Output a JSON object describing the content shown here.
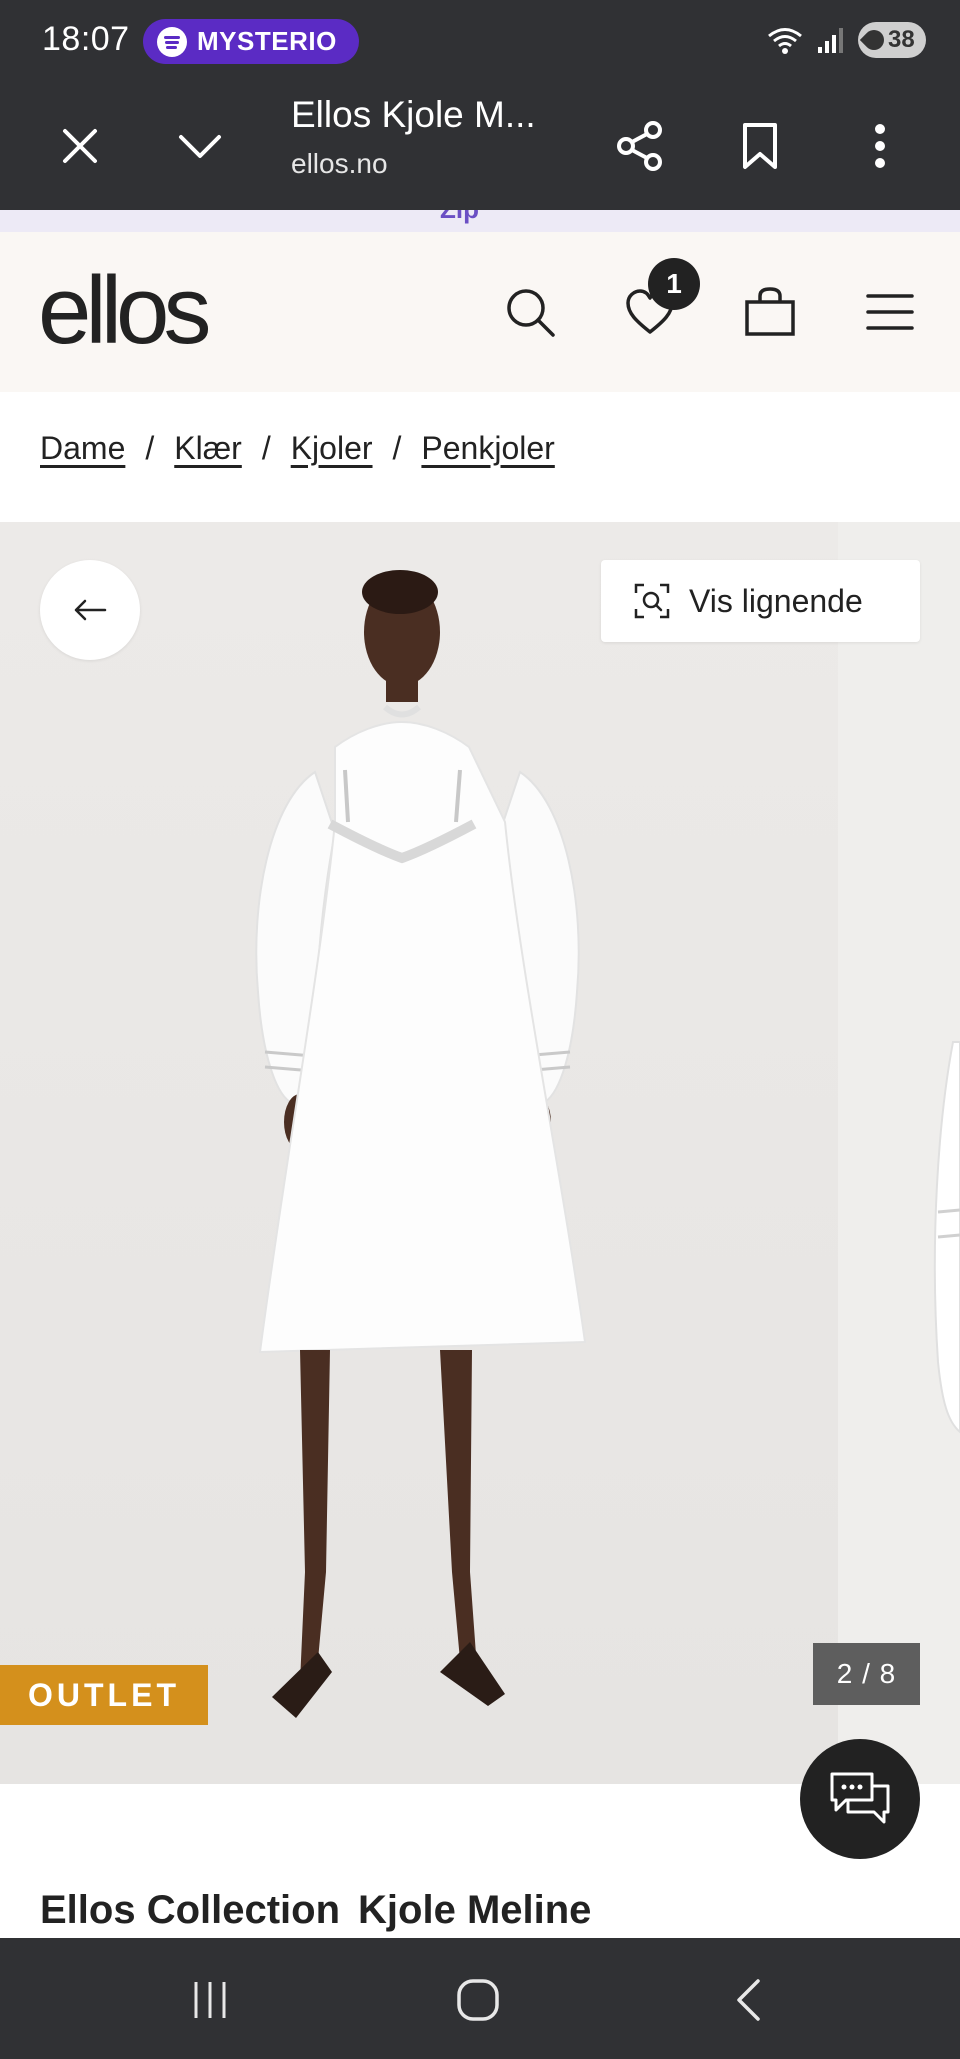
{
  "status_bar": {
    "time": "18:07",
    "media_pill": "MYSTERIO",
    "battery_level": "38",
    "icons": [
      "spotify-icon",
      "wifi-icon",
      "signal-icon",
      "battery-icon"
    ]
  },
  "browser": {
    "tab_title": "Ellos Kjole M...",
    "url": "ellos.no",
    "icons": [
      "close-icon",
      "chevron-down-icon",
      "share-icon",
      "bookmark-icon",
      "more-vert-icon"
    ]
  },
  "site": {
    "promo_text": "Zip",
    "logo": "ellos",
    "favorites_count": "1",
    "header_icons": [
      "search-icon",
      "heart-icon",
      "bag-icon",
      "menu-icon"
    ]
  },
  "breadcrumb": {
    "items": [
      {
        "label": "Dame"
      },
      {
        "label": "Klær"
      },
      {
        "label": "Kjoler"
      },
      {
        "label": "Penkjoler"
      }
    ],
    "separator": "/"
  },
  "gallery": {
    "similar_label": "Vis lignende",
    "outlet_label": "OUTLET",
    "counter": "2 / 8",
    "current_image": 2,
    "total_images": 8
  },
  "product": {
    "brand": "Ellos Collection",
    "name": "Kjole Meline"
  },
  "colors": {
    "system_bar": "#303134",
    "spotify_pill": "#5b2bc4",
    "header_bg": "#faf7f4",
    "outlet_badge": "#d4901c",
    "counter_bg": "#5e5e5e"
  }
}
